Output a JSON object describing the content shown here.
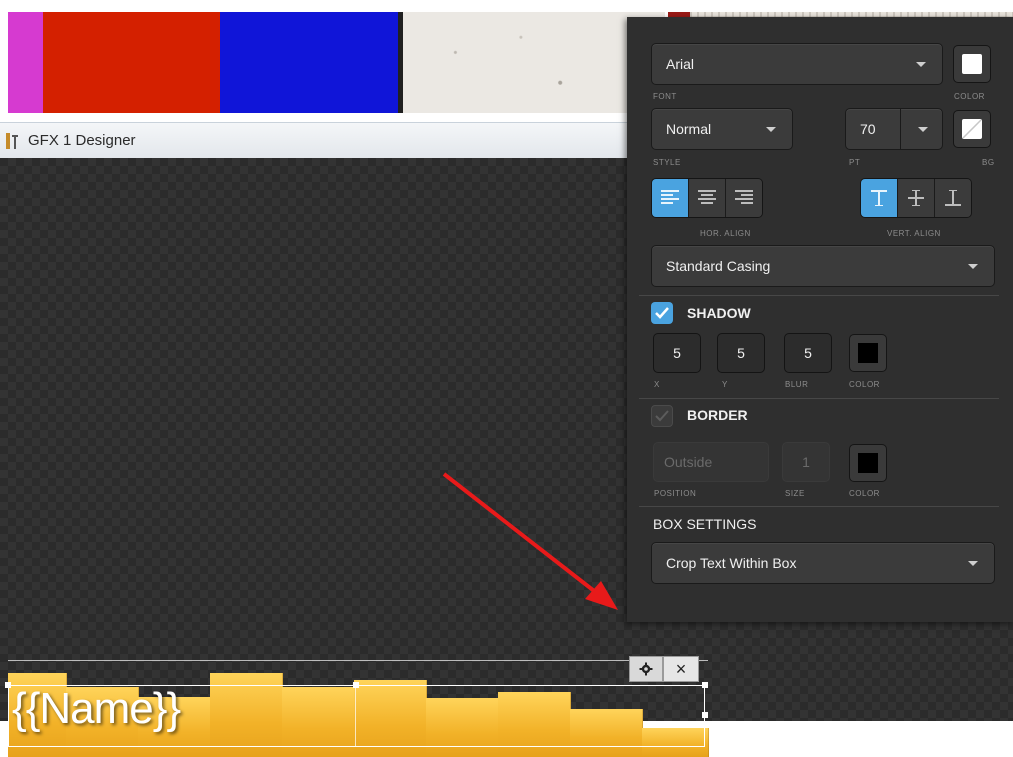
{
  "window": {
    "title": "GFX 1 Designer"
  },
  "lower_third": {
    "text": "{{Name}}",
    "bar_color": "#f2b228"
  },
  "toolbar": {
    "gear_icon": "gear-icon",
    "close_label": "×"
  },
  "panel": {
    "font": {
      "value": "Arial",
      "caption": "FONT",
      "color_caption": "COLOR"
    },
    "style": {
      "value": "Normal",
      "caption": "STYLE",
      "pt_value": "70",
      "pt_caption": "PT",
      "bg_caption": "BG"
    },
    "hor_align": {
      "caption": "HOR. ALIGN",
      "selected": "left"
    },
    "vert_align": {
      "caption": "VERT. ALIGN",
      "selected": "top"
    },
    "casing": {
      "value": "Standard Casing"
    },
    "shadow": {
      "title": "SHADOW",
      "checked": true,
      "x": "5",
      "y": "5",
      "blur": "5",
      "x_caption": "X",
      "y_caption": "Y",
      "blur_caption": "BLUR",
      "color_caption": "COLOR"
    },
    "border": {
      "title": "BORDER",
      "checked": false,
      "position": "Outside",
      "size": "1",
      "position_caption": "POSITION",
      "size_caption": "SIZE",
      "color_caption": "COLOR"
    },
    "box_settings": {
      "title": "BOX SETTINGS",
      "value": "Crop Text Within Box"
    }
  },
  "colors": {
    "accent": "#4aa3e0",
    "panel_bg": "#2f2f2f",
    "annotation_arrow": "#e81a1a"
  }
}
